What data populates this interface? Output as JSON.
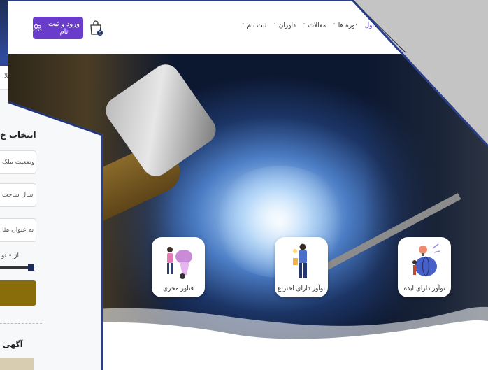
{
  "background_screenshot": {
    "topnav_text": "املا",
    "filter_title": "انتخاب خ",
    "filters": [
      {
        "label": "وضعیت ملک"
      },
      {
        "label": "سال ساخت"
      },
      {
        "label": "به عنوان مثا"
      }
    ],
    "range_label": "از • تو",
    "ads_title": "آگهی"
  },
  "header": {
    "login_label": "ورود و ثبت نام",
    "nav": [
      {
        "label": "اصلی اول",
        "active": true,
        "has_chevron": false
      },
      {
        "label": "دوره ها",
        "active": false,
        "has_chevron": true
      },
      {
        "label": "مقالات",
        "active": false,
        "has_chevron": true
      },
      {
        "label": "داوران",
        "active": false,
        "has_chevron": true
      },
      {
        "label": "ثبت نام",
        "active": false,
        "has_chevron": true
      }
    ],
    "chevron": "˅"
  },
  "cards": [
    {
      "label": "فناور مجری",
      "icon": "technologist-icon"
    },
    {
      "label": "نوآور دارای اختراع",
      "icon": "inventor-icon"
    },
    {
      "label": "نوآور دارای ایده",
      "icon": "idea-brain-icon"
    }
  ],
  "colors": {
    "accent": "#6a3ccc",
    "frame_border": "#2a3f8a",
    "gold": "#8a6d0b"
  }
}
